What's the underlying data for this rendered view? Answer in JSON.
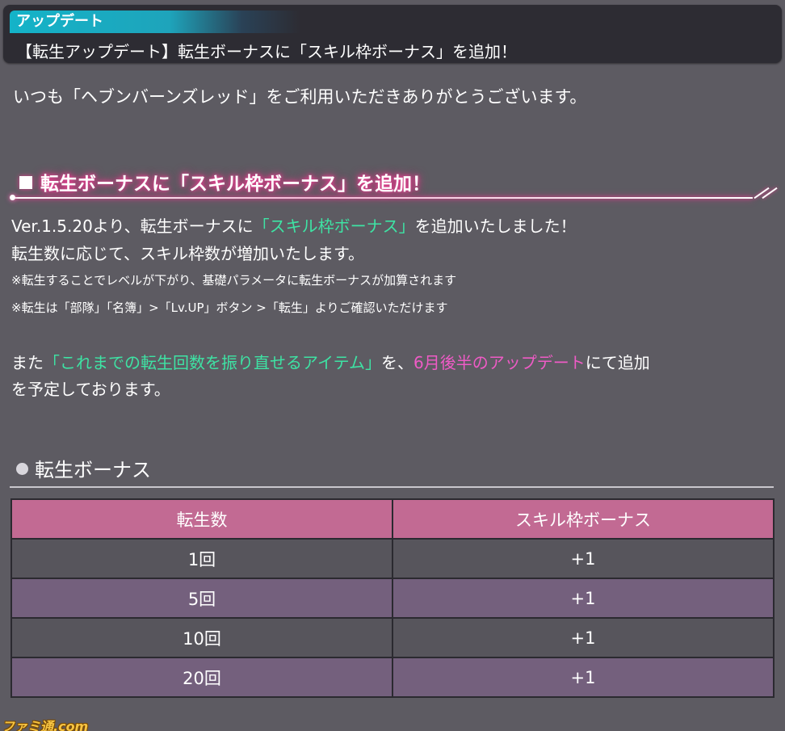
{
  "header": {
    "tag": "アップデート",
    "title": "【転生アップデート】転生ボーナスに「スキル枠ボーナス」を追加！"
  },
  "greeting": "いつも「ヘブンバーンズレッド」をご利用いただきありがとうございます。",
  "section": {
    "heading": "転生ボーナスに「スキル枠ボーナス」を追加！",
    "line1_pre": "Ver.1.5.20より、転生ボーナスに",
    "line1_hl": "「スキル枠ボーナス」",
    "line1_post": "を追加いたしました！",
    "line2": "転生数に応じて、スキル枠数が増加いたします。",
    "note1": "※転生することでレベルが下がり、基礎パラメータに転生ボーナスが加算されます",
    "note2": "※転生は「部隊」「名簿」>「Lv.UP」ボタン >「転生」よりご確認いただけます",
    "line3_pre": "また",
    "line3_hl1": "「これまでの転生回数を振り直せるアイテム」",
    "line3_mid": "を、",
    "line3_hl2": "6月後半のアップデート",
    "line3_post": "にて追加",
    "line4": "を予定しております。"
  },
  "bonus": {
    "heading": "転生ボーナス",
    "columns": [
      "転生数",
      "スキル枠ボーナス"
    ],
    "rows": [
      {
        "count": "1回",
        "bonus": "+1"
      },
      {
        "count": "5回",
        "bonus": "+1"
      },
      {
        "count": "10回",
        "bonus": "+1"
      },
      {
        "count": "20回",
        "bonus": "+1"
      }
    ]
  },
  "watermark": "ファミ通.com",
  "colors": {
    "background": "#5d5b62",
    "header_box": "#2d2c33",
    "tag_accent": "#14b3c8",
    "heading_glow": "#e2418f",
    "highlight_green": "#3ee3a4",
    "highlight_pink": "#ef5bc6",
    "table_header": "#c26a93",
    "row_dark": "#57555c",
    "row_purple": "#74607d"
  },
  "icons": [
    "square-bullet-icon",
    "circle-bullet-icon"
  ]
}
